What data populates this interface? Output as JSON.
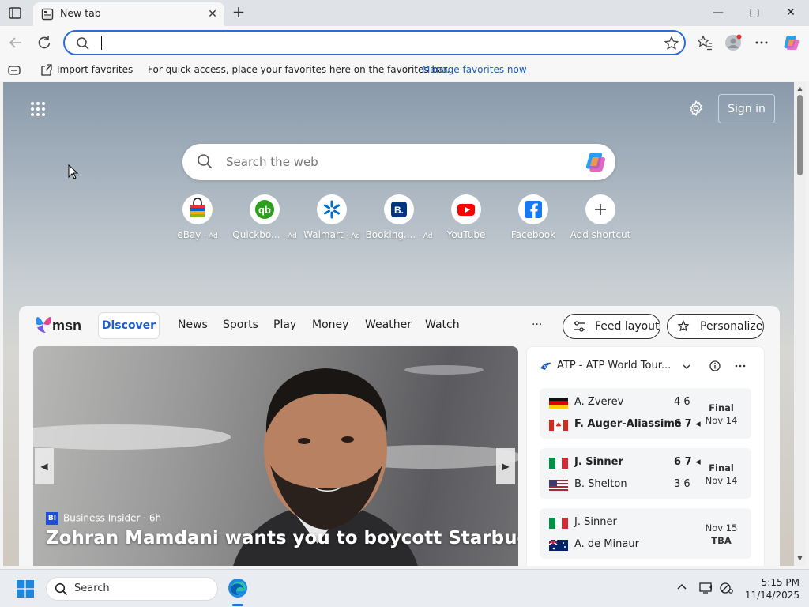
{
  "browser": {
    "tab_title": "New tab",
    "tab_close": "✕",
    "new_tab": "+",
    "window": {
      "minimize": "—",
      "maximize": "▢",
      "close": "✕"
    },
    "address_value": "",
    "favorites_bar": {
      "import_label": "Import favorites",
      "message": "For quick access, place your favorites here on the favorites bar.",
      "manage_link": "Manage favorites now"
    }
  },
  "newtab": {
    "sign_in": "Sign in",
    "search_placeholder": "Search the web",
    "shortcuts": [
      {
        "label": "eBay",
        "ad": "· Ad"
      },
      {
        "label": "Quickbo...",
        "ad": "· Ad"
      },
      {
        "label": "Walmart",
        "ad": "· Ad"
      },
      {
        "label": "Booking....",
        "ad": "· Ad"
      },
      {
        "label": "YouTube",
        "ad": ""
      },
      {
        "label": "Facebook",
        "ad": ""
      },
      {
        "label": "Add shortcut",
        "ad": ""
      }
    ]
  },
  "msn": {
    "logo": "msn",
    "tabs": [
      "Discover",
      "News",
      "Sports",
      "Play",
      "Money",
      "Weather",
      "Watch"
    ],
    "more": "···",
    "feed_layout": "Feed layout",
    "personalize": "Personalize",
    "hero": {
      "source_badge": "BI",
      "source": "Business Insider",
      "age": "· 6h",
      "title": "Zohran Mamdani wants you to boycott Starbucks"
    },
    "sports": {
      "league": "ATP - ATP World Tour...",
      "matches": [
        {
          "p1": "A. Zverev",
          "s1": "4 6",
          "p2": "F. Auger-Aliassime",
          "s2": "6 7 ◂",
          "status": "Final",
          "date": "Nov 14",
          "winner": 2
        },
        {
          "p1": "J. Sinner",
          "s1": "6 7 ◂",
          "p2": "B. Shelton",
          "s2": "3 6",
          "status": "Final",
          "date": "Nov 14",
          "winner": 1
        },
        {
          "p1": "J. Sinner",
          "s1": "",
          "p2": "A. de Minaur",
          "s2": "",
          "status": "Nov 15",
          "date": "TBA",
          "winner": 0
        }
      ]
    }
  },
  "taskbar": {
    "search_label": "Search",
    "time": "5:15 PM",
    "date": "11/14/2025"
  },
  "colors": {
    "accent": "#2b6cd9",
    "msn_blue": "#1f5ec9"
  }
}
